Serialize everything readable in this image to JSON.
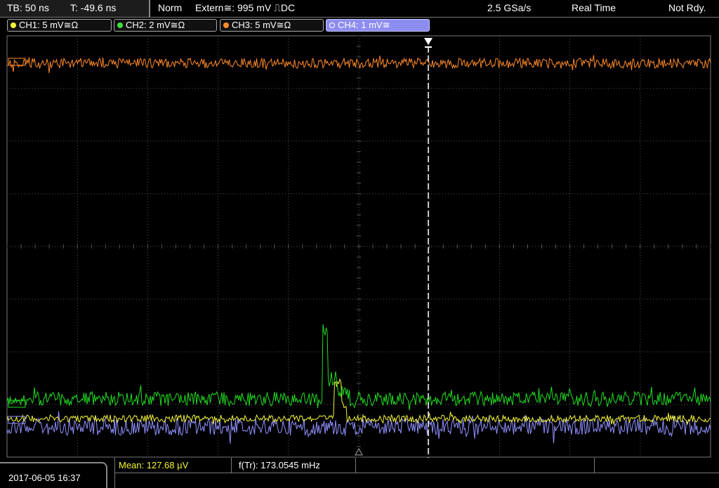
{
  "status": {
    "timebase": "TB: 50 ns",
    "trigger_offset": "T: -49.6 ns",
    "mode": "Norm",
    "trigger_source": "Extern≅: 995 mV ⎍DC",
    "sample_rate": "2.5 GSa/s",
    "acq_mode": "Real Time",
    "state": "Not Rdy."
  },
  "channels": [
    {
      "label": "CH1: 5 mV≅Ω",
      "color": "#f5f53a",
      "active": false
    },
    {
      "label": "CH2: 2 mV≅Ω",
      "color": "#3ee03e",
      "active": false
    },
    {
      "label": "CH3: 5 mV≅Ω",
      "color": "#ff8a2a",
      "active": false
    },
    {
      "label": "CH4: 1 mV≅",
      "color": "#9999ff",
      "active": true
    }
  ],
  "footer": {
    "datetime": "2017-06-05 16:37",
    "mean": "Mean: 127.68 µV",
    "freq": "f(Tr): 173.0545 mHz"
  },
  "colors": {
    "ch1": "#f5f53a",
    "ch2": "#22dd22",
    "ch3": "#ff8a2a",
    "ch4": "#9090ff",
    "grid": "#555555",
    "trigger_line": "#ffffff"
  }
}
